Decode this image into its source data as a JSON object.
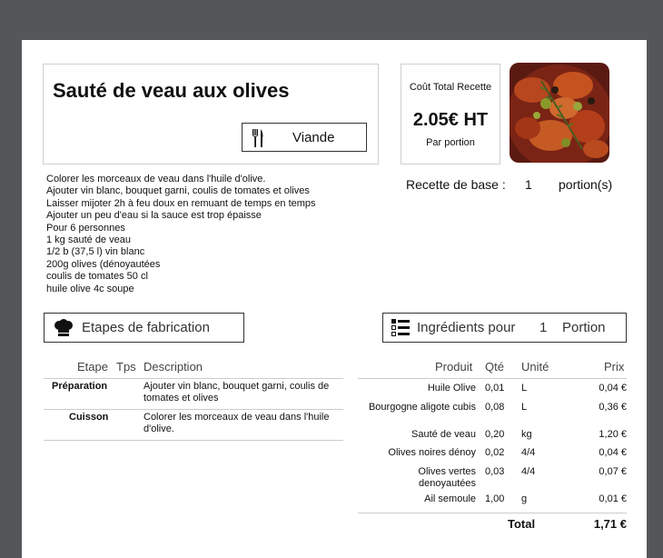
{
  "recipe": {
    "title": "Sauté de veau aux olives",
    "category": "Viande",
    "cost_label": "Coût Total Recette",
    "cost_value": "2.05€ HT",
    "cost_unit": "Par portion",
    "description_lines": [
      "Colorer les morceaux de veau dans l'huile d'olive.",
      "Ajouter vin blanc, bouquet garni, coulis de tomates et olives",
      "Laisser mijoter 2h à feu doux en remuant de temps en temps",
      "Ajouter un peu d'eau si la sauce est trop épaisse",
      "Pour 6 personnes",
      "1 kg sauté de veau",
      "1/2 b (37,5 l)  vin blanc",
      "200g olives (dénoyautées",
      "coulis de tomates 50 cl",
      "huile olive 4c soupe"
    ],
    "base_label": "Recette de base :",
    "base_value": "1",
    "base_unit": "portion(s)"
  },
  "steps_section": {
    "title": "Etapes de fabrication",
    "headers": {
      "etape": "Etape",
      "tps": "Tps",
      "description": "Description"
    },
    "rows": [
      {
        "etape": "Préparation",
        "tps": "",
        "desc1": "Ajouter vin blanc, bouquet garni, coulis de",
        "desc2": "tomates et olives"
      },
      {
        "etape": "Cuisson",
        "tps": "",
        "desc1": "Colorer les morceaux de veau dans l'huile",
        "desc2": "d'olive."
      }
    ]
  },
  "ingredients_section": {
    "title": "Ingrédients pour",
    "portions": "1",
    "portion_label": "Portion",
    "headers": {
      "produit": "Produit",
      "qte": "Qté",
      "unite": "Unité",
      "prix": "Prix"
    },
    "rows": [
      {
        "p1": "Huile Olive",
        "p2": "",
        "qte": "0,01",
        "unite": "L",
        "prix": "0,04 €"
      },
      {
        "p1": "Bourgogne aligote cubis",
        "p2": "",
        "qte": "0,08",
        "unite": "L",
        "prix": "0,36 €"
      },
      {
        "p1": "Sauté de veau",
        "p2": "",
        "qte": "0,20",
        "unite": "kg",
        "prix": "1,20 €"
      },
      {
        "p1": "Olives noires dénoy",
        "p2": "",
        "qte": "0,02",
        "unite": "4/4",
        "prix": "0,04 €"
      },
      {
        "p1": "Olives vertes",
        "p2": "denoyautées",
        "qte": "0,03",
        "unite": "4/4",
        "prix": "0,07 €"
      },
      {
        "p1": "Ail semoule",
        "p2": "",
        "qte": "1,00",
        "unite": "g",
        "prix": "0,01 €"
      }
    ],
    "total_label": "Total",
    "total_value": "1,71 €"
  }
}
